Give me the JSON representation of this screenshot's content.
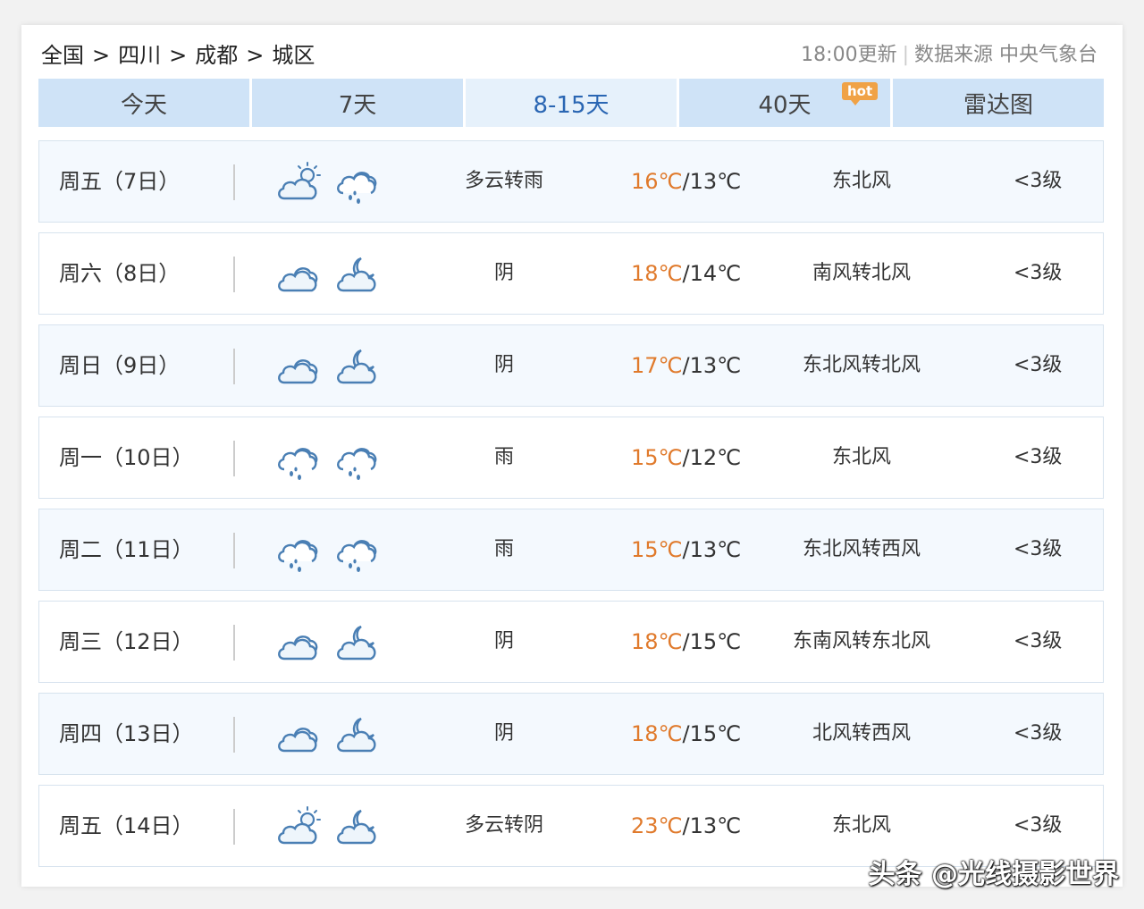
{
  "breadcrumb": [
    "全国",
    "四川",
    "成都",
    "城区"
  ],
  "breadcrumb_sep": ">",
  "update_time": "18:00更新",
  "source": "数据来源 中央气象台",
  "tabs": [
    {
      "label": "今天"
    },
    {
      "label": "7天"
    },
    {
      "label": "8-15天"
    },
    {
      "label": "40天"
    },
    {
      "label": "雷达图"
    }
  ],
  "active_tab": 2,
  "hot_badge": "hot",
  "colors": {
    "accent": "#2a66b3",
    "high_temp": "#e07a2c",
    "icon_stroke": "#4a7fb4"
  },
  "forecast": [
    {
      "date": "周五（7日）",
      "icon_day": "partly-cloudy-sun-icon",
      "icon_night": "rain-cloud-icon",
      "condition": "多云转雨",
      "high": "16℃",
      "low": "/13℃",
      "wind": "东北风",
      "level": "<3级"
    },
    {
      "date": "周六（8日）",
      "icon_day": "cloudy-icon",
      "icon_night": "cloudy-moon-icon",
      "condition": "阴",
      "high": "18℃",
      "low": "/14℃",
      "wind": "南风转北风",
      "level": "<3级"
    },
    {
      "date": "周日（9日）",
      "icon_day": "cloudy-icon",
      "icon_night": "cloudy-moon-icon",
      "condition": "阴",
      "high": "17℃",
      "low": "/13℃",
      "wind": "东北风转北风",
      "level": "<3级"
    },
    {
      "date": "周一（10日）",
      "icon_day": "rain-cloud-icon",
      "icon_night": "rain-cloud-icon",
      "condition": "雨",
      "high": "15℃",
      "low": "/12℃",
      "wind": "东北风",
      "level": "<3级"
    },
    {
      "date": "周二（11日）",
      "icon_day": "rain-cloud-icon",
      "icon_night": "rain-cloud-icon",
      "condition": "雨",
      "high": "15℃",
      "low": "/13℃",
      "wind": "东北风转西风",
      "level": "<3级"
    },
    {
      "date": "周三（12日）",
      "icon_day": "cloudy-icon",
      "icon_night": "cloudy-moon-icon",
      "condition": "阴",
      "high": "18℃",
      "low": "/15℃",
      "wind": "东南风转东北风",
      "level": "<3级"
    },
    {
      "date": "周四（13日）",
      "icon_day": "cloudy-icon",
      "icon_night": "cloudy-moon-icon",
      "condition": "阴",
      "high": "18℃",
      "low": "/15℃",
      "wind": "北风转西风",
      "level": "<3级"
    },
    {
      "date": "周五（14日）",
      "icon_day": "partly-cloudy-sun-icon",
      "icon_night": "cloudy-moon-icon",
      "condition": "多云转阴",
      "high": "23℃",
      "low": "/13℃",
      "wind": "东北风",
      "level": "<3级"
    }
  ],
  "watermark": "头条 @光线摄影世界"
}
